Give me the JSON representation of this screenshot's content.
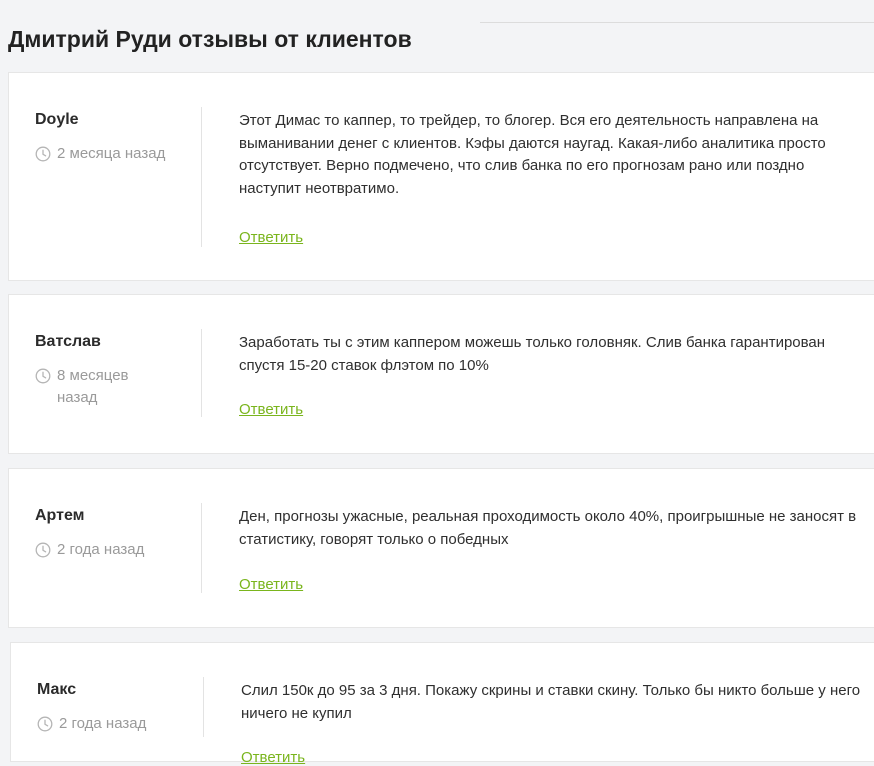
{
  "page": {
    "title": "Дмитрий Руди отзывы от клиентов"
  },
  "reviews": [
    {
      "author": "Doyle",
      "time": "2 месяца назад",
      "text": "Этот Димас то каппер, то трейдер, то блогер. Вся его деятельность направлена на выманивании денег с клиентов. Кэфы даются наугад. Какая-либо аналитика просто отсутствует. Верно подмечено, что слив банка по его прогнозам рано или поздно наступит неотвратимо.",
      "reply_label": "Ответить"
    },
    {
      "author": "Ватслав",
      "time": "8 месяцев назад",
      "text": "Заработать ты с этим каппером можешь только головняк. Слив банка гарантирован спустя 15-20 ставок флэтом по 10%",
      "reply_label": "Ответить"
    },
    {
      "author": "Артем",
      "time": "2 года назад",
      "text": "Ден, прогнозы ужасные, реальная проходимость около 40%, проигрышные не заносят в статистику, говорят только о победных",
      "reply_label": "Ответить"
    },
    {
      "author": "Макс",
      "time": "2 года назад",
      "text": "Слил 150к до 95 за 3 дня. Покажу скрины и ставки скину. Только бы никто больше у него ничего не купил",
      "reply_label": "Ответить"
    }
  ],
  "icons": {
    "time": "clock-icon"
  },
  "colors": {
    "accent": "#7ab51d",
    "muted": "#9a9a9a"
  }
}
